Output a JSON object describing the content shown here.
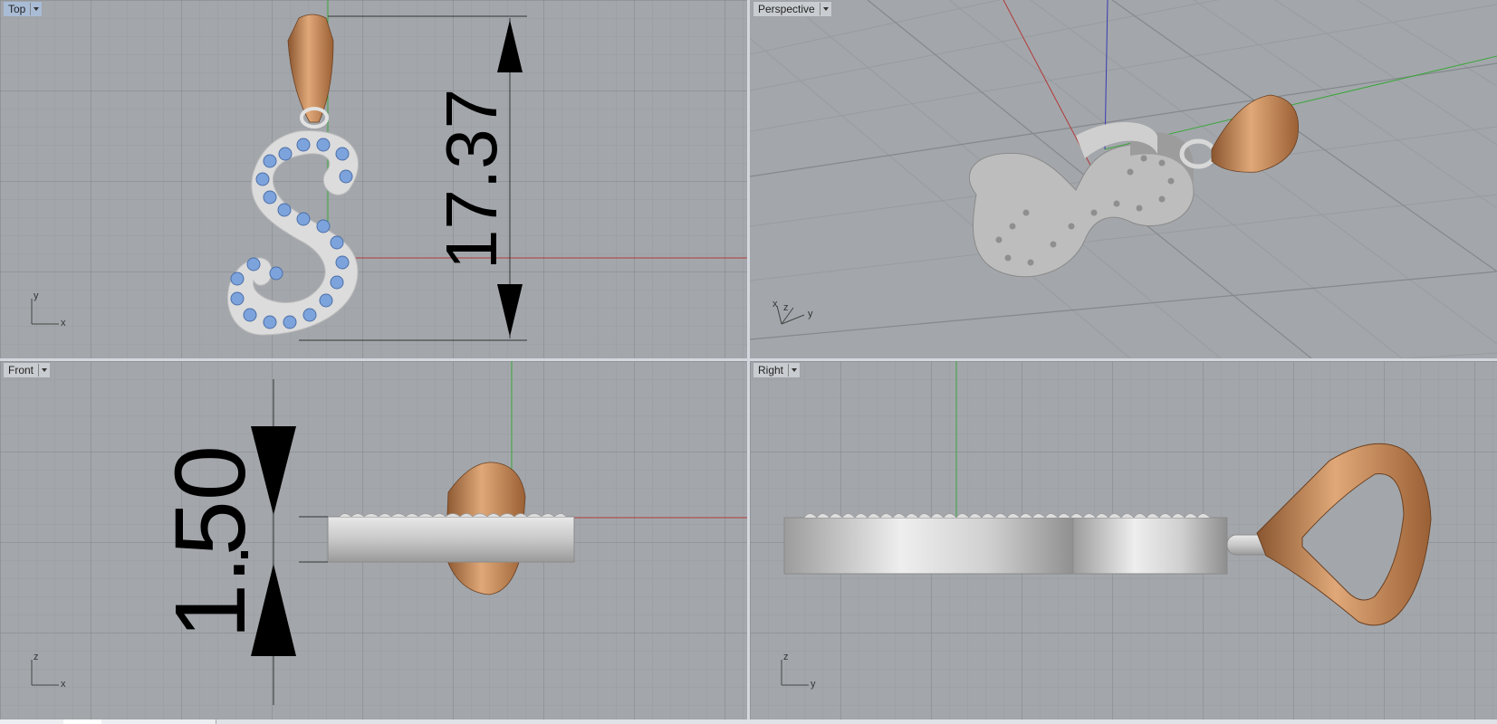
{
  "viewports": {
    "top": {
      "label": "Top",
      "dimension": "17.37",
      "axis_h": "x",
      "axis_v": "y"
    },
    "perspective": {
      "label": "Perspective",
      "axis_a": "x",
      "axis_b": "z",
      "axis_c": "y"
    },
    "front": {
      "label": "Front",
      "dimension": "1.50",
      "axis_h": "x",
      "axis_v": "z"
    },
    "right": {
      "label": "Right",
      "axis_h": "y",
      "axis_v": "z"
    }
  },
  "colors": {
    "viewport_bg": "#a3a7ab",
    "grid_minor": "#9a9ea3",
    "grid_major": "#8b8f94",
    "x_axis": "#b23a3a",
    "y_axis": "#3aa83a",
    "z_axis": "#3a3ab2",
    "silver": "#d8d8d8",
    "rose_gold": "#c48a5c",
    "gem_blue": "#7a9fd6"
  }
}
